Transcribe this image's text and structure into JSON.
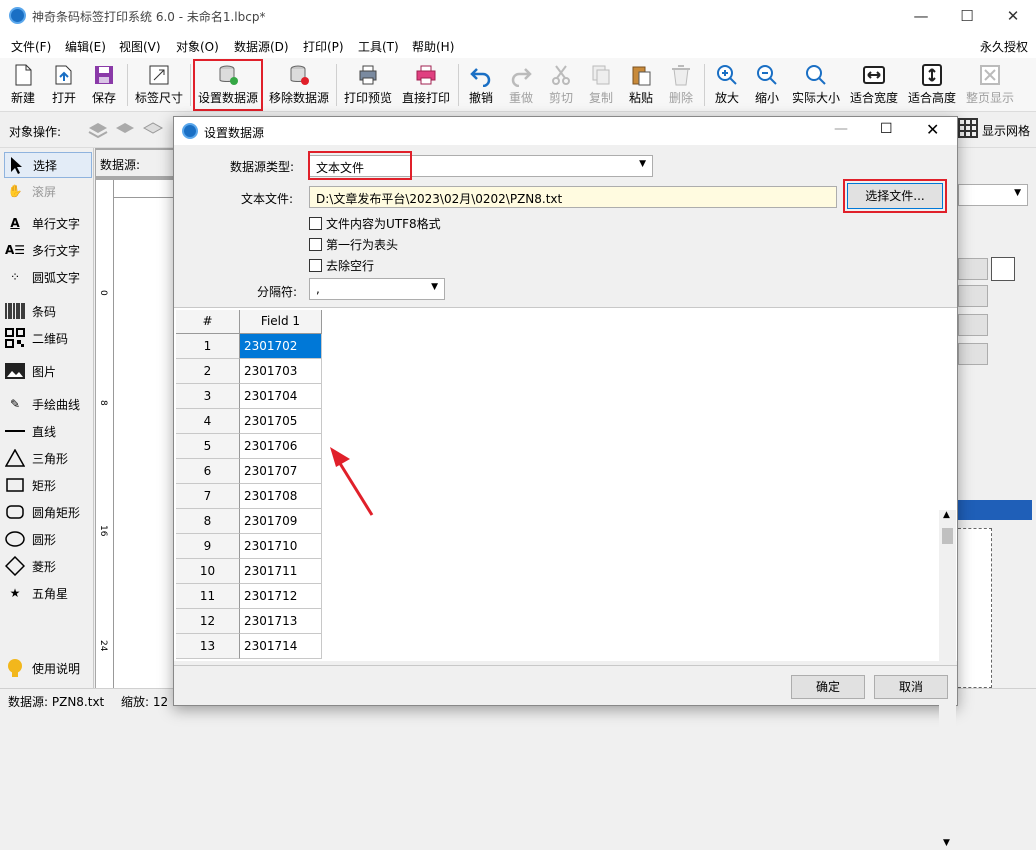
{
  "app": {
    "title": "神奇条码标签打印系统 6.0 - 未命名1.lbcp*"
  },
  "menus": [
    "文件(F)",
    "编辑(E)",
    "视图(V)",
    "对象(O)",
    "数据源(D)",
    "打印(P)",
    "工具(T)",
    "帮助(H)"
  ],
  "license": "永久授权",
  "toolbar": [
    "新建",
    "打开",
    "保存",
    "标签尺寸",
    "设置数据源",
    "移除数据源",
    "打印预览",
    "直接打印",
    "撤销",
    "重做",
    "剪切",
    "复制",
    "粘贴",
    "删除",
    "放大",
    "缩小",
    "实际大小",
    "适合宽度",
    "适合高度",
    "整页显示"
  ],
  "objbar": {
    "label": "对象操作:",
    "grid_label": "显示网格",
    "datasource_label": "数据源:"
  },
  "tools": [
    "选择",
    "滚屏",
    "单行文字",
    "多行文字",
    "圆弧文字",
    "条码",
    "二维码",
    "图片",
    "手绘曲线",
    "直线",
    "三角形",
    "矩形",
    "圆角矩形",
    "圆形",
    "菱形",
    "五角星",
    "使用说明"
  ],
  "ruler": {
    "marks": [
      "0",
      "8",
      "16",
      "24"
    ]
  },
  "status": {
    "datasource": "数据源:  PZN8.txt",
    "zoom": "缩放: 12"
  },
  "dialog": {
    "title": "设置数据源",
    "type_label": "数据源类型:",
    "type_value": "文本文件",
    "file_label": "文本文件:",
    "file_value": "D:\\文章发布平台\\2023\\02月\\0202\\PZN8.txt",
    "choose_button": "选择文件...",
    "options": [
      "文件内容为UTF8格式",
      "第一行为表头",
      "去除空行"
    ],
    "sep_label": "分隔符:",
    "sep_value": ",",
    "columns": [
      "#",
      "Field 1"
    ],
    "rows": [
      [
        "1",
        "2301702"
      ],
      [
        "2",
        "2301703"
      ],
      [
        "3",
        "2301704"
      ],
      [
        "4",
        "2301705"
      ],
      [
        "5",
        "2301706"
      ],
      [
        "6",
        "2301707"
      ],
      [
        "7",
        "2301708"
      ],
      [
        "8",
        "2301709"
      ],
      [
        "9",
        "2301710"
      ],
      [
        "10",
        "2301711"
      ],
      [
        "11",
        "2301712"
      ],
      [
        "12",
        "2301713"
      ],
      [
        "13",
        "2301714"
      ]
    ],
    "ok": "确定",
    "cancel": "取消"
  },
  "colors": {
    "highlight": "#0078d7",
    "annotation": "#e0202a"
  }
}
